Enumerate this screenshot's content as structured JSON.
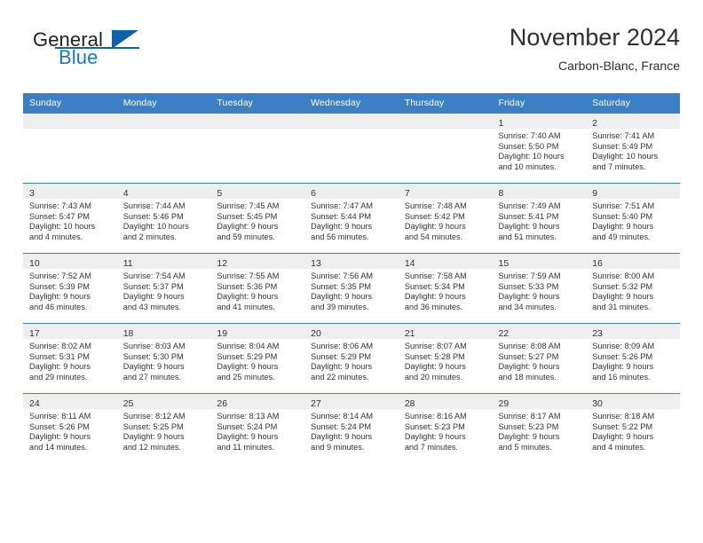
{
  "brand": {
    "name_part1": "General",
    "name_part2": "Blue",
    "mark": "triangle-mark"
  },
  "header": {
    "title": "November 2024",
    "subtitle": "Carbon-Blanc, France"
  },
  "colors": {
    "header_blue": "#3c7fc4",
    "day_band_gray": "#eeeeee",
    "brand_blue": "#1577c4",
    "brand_dark": "#231f20",
    "text": "#333333"
  },
  "weekday_headers": [
    "Sunday",
    "Monday",
    "Tuesday",
    "Wednesday",
    "Thursday",
    "Friday",
    "Saturday"
  ],
  "weeks": [
    [
      {
        "day": "",
        "empty": true,
        "sunrise": "",
        "sunset": "",
        "daylight_line1": "",
        "daylight_line2": ""
      },
      {
        "day": "",
        "empty": true,
        "sunrise": "",
        "sunset": "",
        "daylight_line1": "",
        "daylight_line2": ""
      },
      {
        "day": "",
        "empty": true,
        "sunrise": "",
        "sunset": "",
        "daylight_line1": "",
        "daylight_line2": ""
      },
      {
        "day": "",
        "empty": true,
        "sunrise": "",
        "sunset": "",
        "daylight_line1": "",
        "daylight_line2": ""
      },
      {
        "day": "",
        "empty": true,
        "sunrise": "",
        "sunset": "",
        "daylight_line1": "",
        "daylight_line2": ""
      },
      {
        "day": "1",
        "empty": false,
        "sunrise": "Sunrise: 7:40 AM",
        "sunset": "Sunset: 5:50 PM",
        "daylight_line1": "Daylight: 10 hours",
        "daylight_line2": "and 10 minutes."
      },
      {
        "day": "2",
        "empty": false,
        "sunrise": "Sunrise: 7:41 AM",
        "sunset": "Sunset: 5:49 PM",
        "daylight_line1": "Daylight: 10 hours",
        "daylight_line2": "and 7 minutes."
      }
    ],
    [
      {
        "day": "3",
        "empty": false,
        "sunrise": "Sunrise: 7:43 AM",
        "sunset": "Sunset: 5:47 PM",
        "daylight_line1": "Daylight: 10 hours",
        "daylight_line2": "and 4 minutes."
      },
      {
        "day": "4",
        "empty": false,
        "sunrise": "Sunrise: 7:44 AM",
        "sunset": "Sunset: 5:46 PM",
        "daylight_line1": "Daylight: 10 hours",
        "daylight_line2": "and 2 minutes."
      },
      {
        "day": "5",
        "empty": false,
        "sunrise": "Sunrise: 7:45 AM",
        "sunset": "Sunset: 5:45 PM",
        "daylight_line1": "Daylight: 9 hours",
        "daylight_line2": "and 59 minutes."
      },
      {
        "day": "6",
        "empty": false,
        "sunrise": "Sunrise: 7:47 AM",
        "sunset": "Sunset: 5:44 PM",
        "daylight_line1": "Daylight: 9 hours",
        "daylight_line2": "and 56 minutes."
      },
      {
        "day": "7",
        "empty": false,
        "sunrise": "Sunrise: 7:48 AM",
        "sunset": "Sunset: 5:42 PM",
        "daylight_line1": "Daylight: 9 hours",
        "daylight_line2": "and 54 minutes."
      },
      {
        "day": "8",
        "empty": false,
        "sunrise": "Sunrise: 7:49 AM",
        "sunset": "Sunset: 5:41 PM",
        "daylight_line1": "Daylight: 9 hours",
        "daylight_line2": "and 51 minutes."
      },
      {
        "day": "9",
        "empty": false,
        "sunrise": "Sunrise: 7:51 AM",
        "sunset": "Sunset: 5:40 PM",
        "daylight_line1": "Daylight: 9 hours",
        "daylight_line2": "and 49 minutes."
      }
    ],
    [
      {
        "day": "10",
        "empty": false,
        "sunrise": "Sunrise: 7:52 AM",
        "sunset": "Sunset: 5:39 PM",
        "daylight_line1": "Daylight: 9 hours",
        "daylight_line2": "and 46 minutes."
      },
      {
        "day": "11",
        "empty": false,
        "sunrise": "Sunrise: 7:54 AM",
        "sunset": "Sunset: 5:37 PM",
        "daylight_line1": "Daylight: 9 hours",
        "daylight_line2": "and 43 minutes."
      },
      {
        "day": "12",
        "empty": false,
        "sunrise": "Sunrise: 7:55 AM",
        "sunset": "Sunset: 5:36 PM",
        "daylight_line1": "Daylight: 9 hours",
        "daylight_line2": "and 41 minutes."
      },
      {
        "day": "13",
        "empty": false,
        "sunrise": "Sunrise: 7:56 AM",
        "sunset": "Sunset: 5:35 PM",
        "daylight_line1": "Daylight: 9 hours",
        "daylight_line2": "and 39 minutes."
      },
      {
        "day": "14",
        "empty": false,
        "sunrise": "Sunrise: 7:58 AM",
        "sunset": "Sunset: 5:34 PM",
        "daylight_line1": "Daylight: 9 hours",
        "daylight_line2": "and 36 minutes."
      },
      {
        "day": "15",
        "empty": false,
        "sunrise": "Sunrise: 7:59 AM",
        "sunset": "Sunset: 5:33 PM",
        "daylight_line1": "Daylight: 9 hours",
        "daylight_line2": "and 34 minutes."
      },
      {
        "day": "16",
        "empty": false,
        "sunrise": "Sunrise: 8:00 AM",
        "sunset": "Sunset: 5:32 PM",
        "daylight_line1": "Daylight: 9 hours",
        "daylight_line2": "and 31 minutes."
      }
    ],
    [
      {
        "day": "17",
        "empty": false,
        "sunrise": "Sunrise: 8:02 AM",
        "sunset": "Sunset: 5:31 PM",
        "daylight_line1": "Daylight: 9 hours",
        "daylight_line2": "and 29 minutes."
      },
      {
        "day": "18",
        "empty": false,
        "sunrise": "Sunrise: 8:03 AM",
        "sunset": "Sunset: 5:30 PM",
        "daylight_line1": "Daylight: 9 hours",
        "daylight_line2": "and 27 minutes."
      },
      {
        "day": "19",
        "empty": false,
        "sunrise": "Sunrise: 8:04 AM",
        "sunset": "Sunset: 5:29 PM",
        "daylight_line1": "Daylight: 9 hours",
        "daylight_line2": "and 25 minutes."
      },
      {
        "day": "20",
        "empty": false,
        "sunrise": "Sunrise: 8:06 AM",
        "sunset": "Sunset: 5:29 PM",
        "daylight_line1": "Daylight: 9 hours",
        "daylight_line2": "and 22 minutes."
      },
      {
        "day": "21",
        "empty": false,
        "sunrise": "Sunrise: 8:07 AM",
        "sunset": "Sunset: 5:28 PM",
        "daylight_line1": "Daylight: 9 hours",
        "daylight_line2": "and 20 minutes."
      },
      {
        "day": "22",
        "empty": false,
        "sunrise": "Sunrise: 8:08 AM",
        "sunset": "Sunset: 5:27 PM",
        "daylight_line1": "Daylight: 9 hours",
        "daylight_line2": "and 18 minutes."
      },
      {
        "day": "23",
        "empty": false,
        "sunrise": "Sunrise: 8:09 AM",
        "sunset": "Sunset: 5:26 PM",
        "daylight_line1": "Daylight: 9 hours",
        "daylight_line2": "and 16 minutes."
      }
    ],
    [
      {
        "day": "24",
        "empty": false,
        "sunrise": "Sunrise: 8:11 AM",
        "sunset": "Sunset: 5:26 PM",
        "daylight_line1": "Daylight: 9 hours",
        "daylight_line2": "and 14 minutes."
      },
      {
        "day": "25",
        "empty": false,
        "sunrise": "Sunrise: 8:12 AM",
        "sunset": "Sunset: 5:25 PM",
        "daylight_line1": "Daylight: 9 hours",
        "daylight_line2": "and 12 minutes."
      },
      {
        "day": "26",
        "empty": false,
        "sunrise": "Sunrise: 8:13 AM",
        "sunset": "Sunset: 5:24 PM",
        "daylight_line1": "Daylight: 9 hours",
        "daylight_line2": "and 11 minutes."
      },
      {
        "day": "27",
        "empty": false,
        "sunrise": "Sunrise: 8:14 AM",
        "sunset": "Sunset: 5:24 PM",
        "daylight_line1": "Daylight: 9 hours",
        "daylight_line2": "and 9 minutes."
      },
      {
        "day": "28",
        "empty": false,
        "sunrise": "Sunrise: 8:16 AM",
        "sunset": "Sunset: 5:23 PM",
        "daylight_line1": "Daylight: 9 hours",
        "daylight_line2": "and 7 minutes."
      },
      {
        "day": "29",
        "empty": false,
        "sunrise": "Sunrise: 8:17 AM",
        "sunset": "Sunset: 5:23 PM",
        "daylight_line1": "Daylight: 9 hours",
        "daylight_line2": "and 5 minutes."
      },
      {
        "day": "30",
        "empty": false,
        "sunrise": "Sunrise: 8:18 AM",
        "sunset": "Sunset: 5:22 PM",
        "daylight_line1": "Daylight: 9 hours",
        "daylight_line2": "and 4 minutes."
      }
    ]
  ]
}
